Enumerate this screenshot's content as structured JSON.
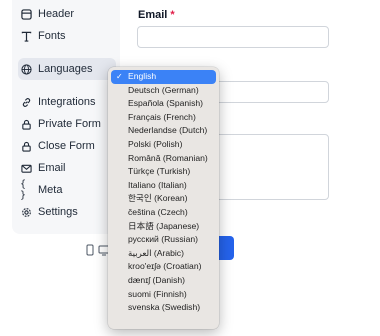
{
  "sidebar": {
    "items": [
      {
        "label": "Header",
        "icon": "layout-icon"
      },
      {
        "label": "Fonts",
        "icon": "type-icon"
      },
      {
        "label": "Languages",
        "icon": "globe-icon"
      },
      {
        "label": "Integrations",
        "icon": "link-icon"
      },
      {
        "label": "Private Form",
        "icon": "lock-icon"
      },
      {
        "label": "Close Form",
        "icon": "lock-icon"
      },
      {
        "label": "Email",
        "icon": "mail-icon"
      },
      {
        "label": "Meta",
        "icon": "braces-icon"
      },
      {
        "label": "Settings",
        "icon": "gear-icon"
      }
    ]
  },
  "form": {
    "email_label": "Email",
    "required_mark": "*"
  },
  "language_menu": {
    "check": "✓",
    "options": [
      "English",
      "Deutsch (German)",
      "Española (Spanish)",
      "Français (French)",
      "Nederlandse (Dutch)",
      "Polski (Polish)",
      "Română (Romanian)",
      "Türkçe (Turkish)",
      "Italiano (Italian)",
      "한국인 (Korean)",
      "čeština (Czech)",
      "日本語 (Japanese)",
      "русский (Russian)",
      "العربية (Arabic)",
      "kroo'eɪʃə (Croatian)",
      "dænɪʃ (Danish)",
      "suomi (Finnish)",
      "svenska (Swedish)"
    ],
    "selected_index": 0
  },
  "colors": {
    "accent": "#3b82f6",
    "submit": "#2563eb",
    "required": "#e11d48"
  }
}
